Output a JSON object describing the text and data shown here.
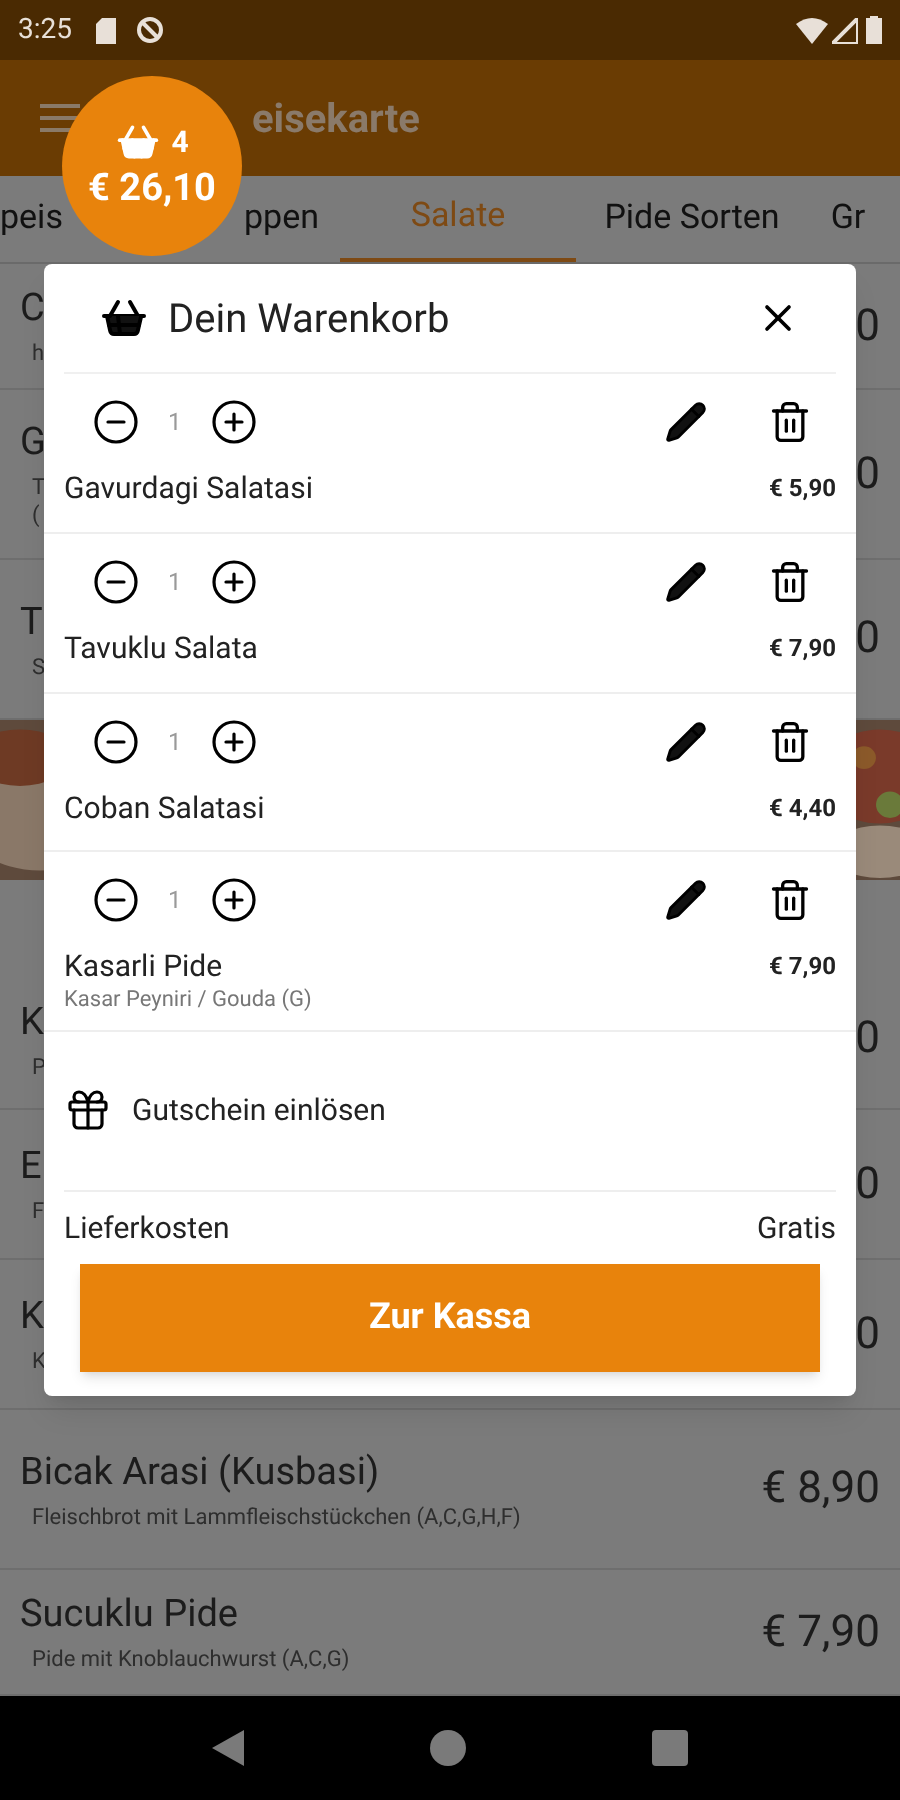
{
  "status_bar": {
    "time": "3:25"
  },
  "app_bar": {
    "title": "eisekarte"
  },
  "cart_bubble": {
    "count": "4",
    "total": "€ 26,10"
  },
  "tabs": [
    {
      "label": "peis",
      "selected": false
    },
    {
      "label": "ppen",
      "selected": false
    },
    {
      "label": "Salate",
      "selected": true
    },
    {
      "label": "Pide Sorten",
      "selected": false
    },
    {
      "label": "Gr",
      "selected": false
    }
  ],
  "menu": [
    {
      "kind": "item",
      "name": "C",
      "description": "h",
      "price": "0"
    },
    {
      "kind": "item",
      "name": "G",
      "description": "T\n(",
      "price": "0"
    },
    {
      "kind": "item",
      "name": "T",
      "description": "S",
      "price": "0"
    },
    {
      "kind": "picture"
    },
    {
      "kind": "item",
      "name": "K",
      "description": "P",
      "price": "0"
    },
    {
      "kind": "item",
      "name": "E",
      "description": "F",
      "price": "0"
    },
    {
      "kind": "item",
      "name": "K",
      "description": "K",
      "price": "0"
    },
    {
      "kind": "item",
      "name": "Bicak Arasi (Kusbasi)",
      "description": "Fleischbrot mit Lammfleischstückchen  (A,C,G,H,F)",
      "price": "€ 8,90"
    },
    {
      "kind": "item",
      "name": "Sucuklu Pide",
      "description": "Pide mit Knoblauchwurst (A,C,G)",
      "price": "€ 7,90"
    }
  ],
  "cart": {
    "title": "Dein Warenkorb",
    "items": [
      {
        "quantity": "1",
        "name": "Gavurdagi Salatasi",
        "price": "€ 5,90"
      },
      {
        "quantity": "1",
        "name": "Tavuklu Salata",
        "price": "€ 7,90"
      },
      {
        "quantity": "1",
        "name": "Coban Salatasi",
        "price": "€ 4,40"
      },
      {
        "quantity": "1",
        "name": "Kasarli Pide",
        "price": "€ 7,90",
        "description": "Kasar Peyniri / Gouda (G)"
      }
    ],
    "voucher": "Gutschein einlösen",
    "delivery_label": "Lieferkosten",
    "delivery_value": "Gratis",
    "checkout": "Zur Kassa"
  }
}
